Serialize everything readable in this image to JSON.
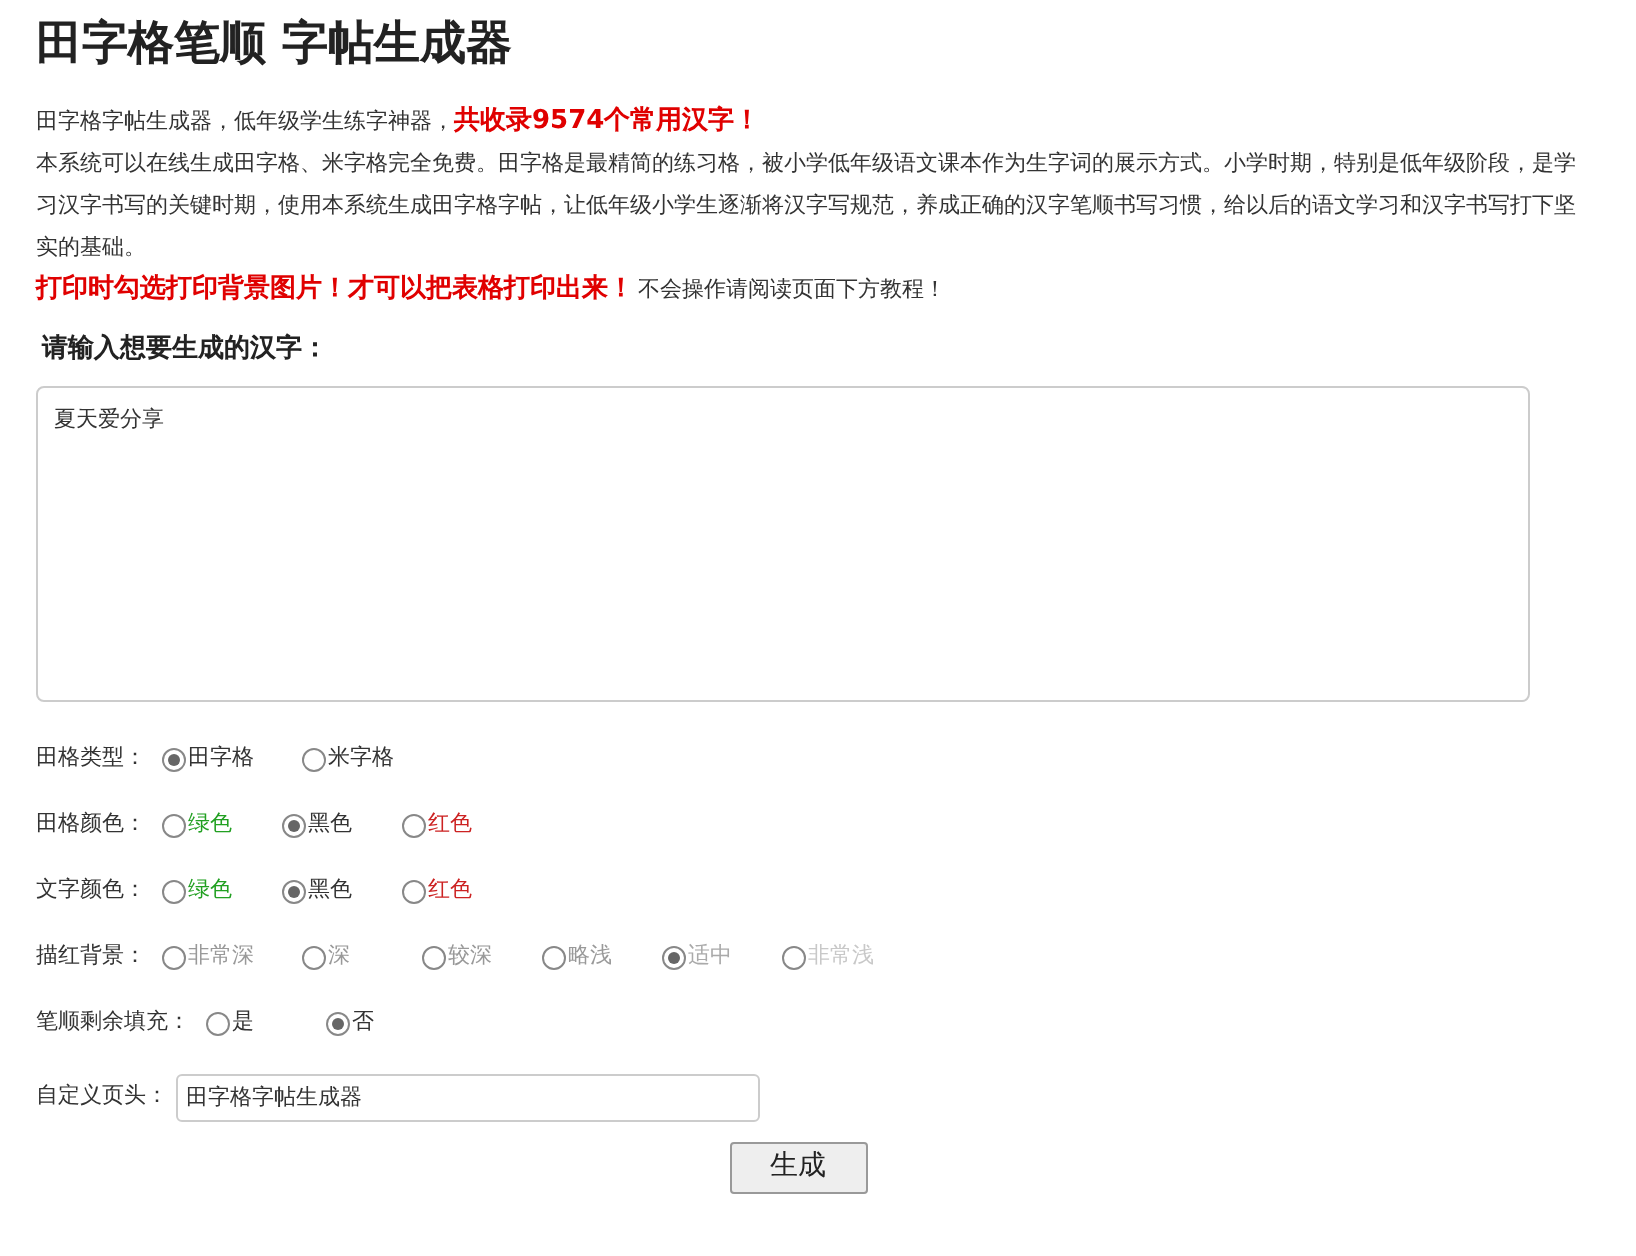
{
  "title": "田字格笔顺 字帖生成器",
  "intro": "田字格字帖生成器，低年级学生练字神器，**共收录9574个常用汉字！**",
  "description": "本系统可以在线生成田字格、米字格完全免费。田字格是最精简的练习格，被小学低年级语文课本作为生字词的展示方式。小学时期，特别是低年级阶段，是学习汉字书写的关键时期，使用本系统生成田字格字帖，让低年级小学生逐渐将汉字写规范，养成正确的汉字笔顺书写习惯，给以后的语文学习和汉字书写打下坚实的基础。",
  "print_notice": {
    "warning": "打印时勾选打印背景图片！才可以把表格打印出来！",
    "hint": "不会操作请阅读页面下方教程！"
  },
  "input_label": "请输入想要生成的汉字：",
  "text_input": {
    "value": "夏天爱分享"
  },
  "options": [
    {
      "label": "田格类型：",
      "choices": [
        {
          "label": "田字格",
          "selected": true,
          "color": "#333333"
        },
        {
          "label": "米字格",
          "selected": false,
          "color": "#333333"
        }
      ]
    },
    {
      "label": "田格颜色：",
      "choices": [
        {
          "label": "绿色",
          "selected": false,
          "color": "#22a022"
        },
        {
          "label": "黑色",
          "selected": true,
          "color": "#333333"
        },
        {
          "label": "红色",
          "selected": false,
          "color": "#cc2222"
        }
      ]
    },
    {
      "label": "文字颜色：",
      "choices": [
        {
          "label": "绿色",
          "selected": false,
          "color": "#22a022"
        },
        {
          "label": "黑色",
          "selected": true,
          "color": "#333333"
        },
        {
          "label": "红色",
          "selected": false,
          "color": "#cc2222"
        }
      ]
    },
    {
      "label": "描红背景：",
      "choices": [
        {
          "label": "非常深",
          "selected": false,
          "color": "#999999"
        },
        {
          "label": "深",
          "selected": false,
          "color": "#999999"
        },
        {
          "label": "较深",
          "selected": false,
          "color": "#999999"
        },
        {
          "label": "略浅",
          "selected": false,
          "color": "#999999"
        },
        {
          "label": "适中",
          "selected": true,
          "color": "#aaaaaa"
        },
        {
          "label": "非常浅",
          "selected": false,
          "color": "#c8c8c8"
        }
      ]
    },
    {
      "label": "笔顺剩余填充：",
      "choices": [
        {
          "label": "是",
          "selected": false,
          "color": "#333333"
        },
        {
          "label": "否",
          "selected": true,
          "color": "#333333"
        }
      ]
    }
  ],
  "header_field": {
    "label": "自定义页头：",
    "value": "田字格字帖生成器"
  },
  "submit_button": "生成"
}
